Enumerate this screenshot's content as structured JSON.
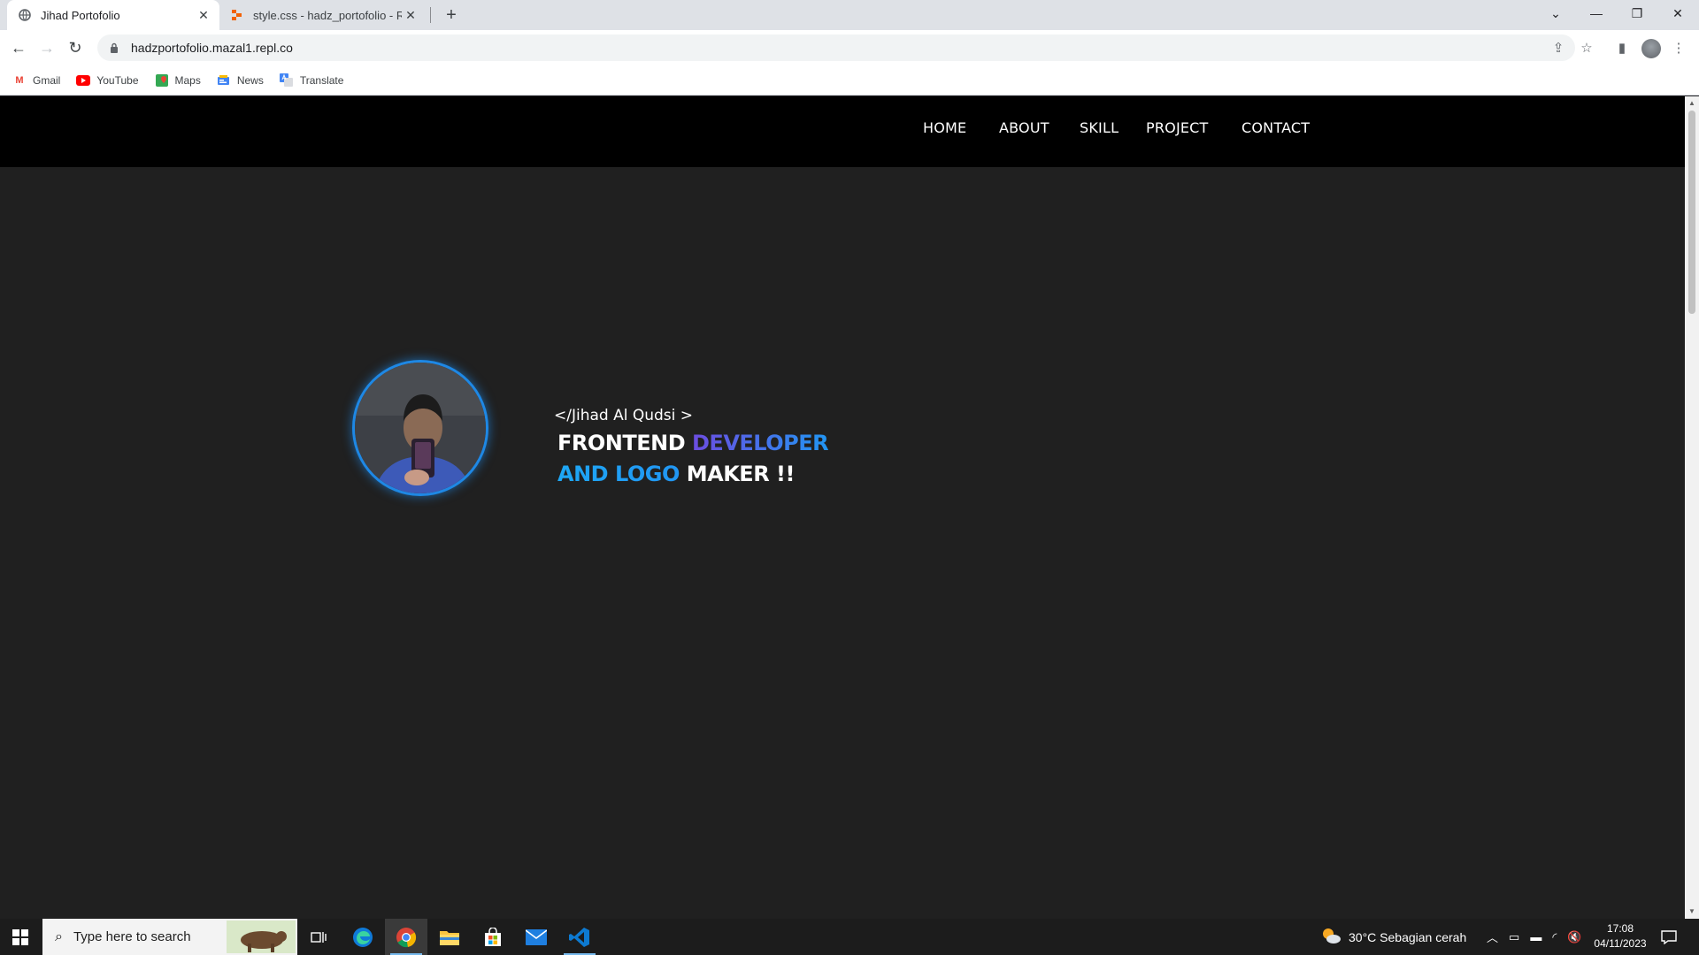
{
  "browser": {
    "tabs": [
      {
        "title": "Jihad Portofolio",
        "favicon": "globe-icon",
        "active": true
      },
      {
        "title": "style.css - hadz_portofolio - Repl",
        "favicon": "replit-icon",
        "active": false
      }
    ],
    "address": "hadzportofolio.mazal1.repl.co",
    "bookmarks": [
      {
        "label": "Gmail",
        "icon": "gmail-icon"
      },
      {
        "label": "YouTube",
        "icon": "youtube-icon"
      },
      {
        "label": "Maps",
        "icon": "maps-icon"
      },
      {
        "label": "News",
        "icon": "news-icon"
      },
      {
        "label": "Translate",
        "icon": "translate-icon"
      }
    ]
  },
  "site": {
    "nav": [
      "HOME",
      "ABOUT",
      "SKILL",
      "PROJECT",
      "CONTACT"
    ],
    "hero": {
      "name": "</Jihad Al Qudsi >",
      "line1_a": "FRONTEND",
      "line1_b": "DEVELOPER",
      "line2_a": "AND LOGO",
      "line2_b": "MAKER !!"
    },
    "colors": {
      "background": "#202020",
      "navbar": "#000000",
      "accent": "#2196f3",
      "accent_purple": "#6c4ce0"
    }
  },
  "taskbar": {
    "search_placeholder": "Type here to search",
    "weather": "30°C  Sebagian cerah",
    "time": "17:08",
    "date": "04/11/2023"
  }
}
